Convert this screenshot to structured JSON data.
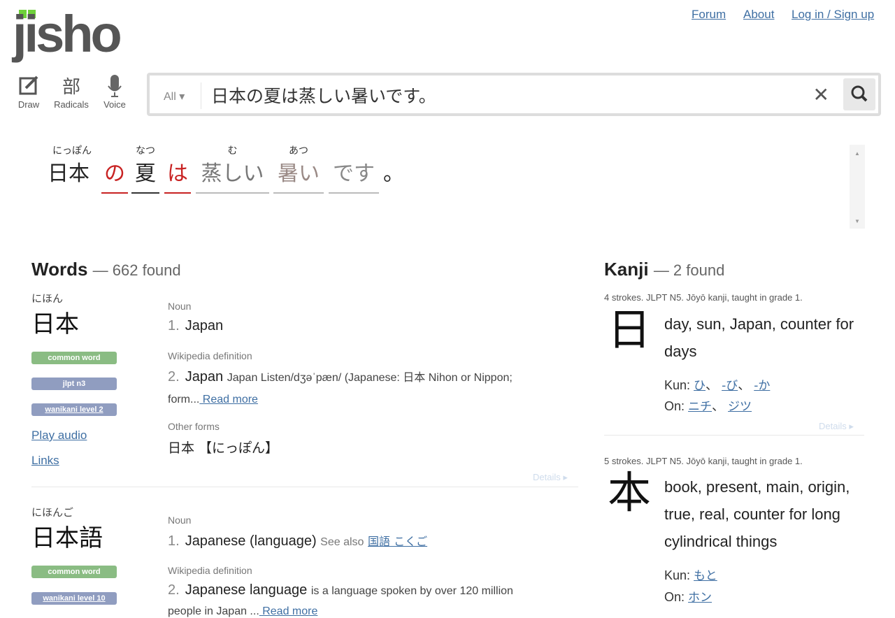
{
  "logo": {
    "text": "jisho",
    "color": "#6ed13a"
  },
  "nav": {
    "forum": "Forum",
    "about": "About",
    "login": "Log in / Sign up"
  },
  "tools": [
    {
      "label": "Draw",
      "icon": "pencil-square-icon"
    },
    {
      "label": "Radicals",
      "glyph": "部"
    },
    {
      "label": "Voice",
      "icon": "microphone-icon"
    }
  ],
  "search": {
    "filter": "All ▾",
    "value": "日本の夏は蒸しい暑いです。",
    "clear": "✕"
  },
  "sentence": [
    {
      "furigana": "にっぽん",
      "text": "日本",
      "color": "#222"
    },
    {
      "furigana": "",
      "text": "の",
      "color": "#c82222"
    },
    {
      "furigana": "なつ",
      "text": "夏",
      "color": "#222"
    },
    {
      "furigana": "",
      "text": "は",
      "color": "#c82222"
    },
    {
      "furigana": "む",
      "text": "蒸しい",
      "color": "#777"
    },
    {
      "furigana": "あつ",
      "text": "暑い",
      "color": "#9a8a86"
    },
    {
      "furigana": "",
      "text": "です",
      "color": "#888"
    },
    {
      "furigana": "",
      "text": "。",
      "color": "#222"
    }
  ],
  "words": {
    "title": "Words",
    "count": "— 662 found",
    "entries": [
      {
        "reading": "にほん",
        "word": "日本",
        "tags": [
          "common word",
          "jlpt n3",
          "wanikani level 2"
        ],
        "play_audio": "Play audio",
        "links": "Links",
        "pos1": "Noun",
        "m1_num": "1.",
        "m1": "Japan",
        "pos2": "Wikipedia definition",
        "m2_num": "2.",
        "m2": "Japan",
        "m2_desc": "Japan Listen/dʒəˈpæn/ (Japanese: 日本 Nihon or Nippon;",
        "m2_desc2": "form...",
        "read_more": " Read more",
        "other_label": "Other forms",
        "other": "日本 【にっぽん】",
        "details": "Details ▸"
      },
      {
        "reading": "にほんご",
        "word": "日本語",
        "tags": [
          "common word",
          "wanikani level 10"
        ],
        "pos1": "Noun",
        "m1_num": "1.",
        "m1": "Japanese (language)",
        "see_also": "See also",
        "see_link": "国語 こくご",
        "pos2": "Wikipedia definition",
        "m2_num": "2.",
        "m2": "Japanese language",
        "m2_desc": "is a language spoken by over 120 million",
        "m2_desc2": "people in Japan ...",
        "read_more": " Read more"
      }
    ]
  },
  "kanji": {
    "title": "Kanji",
    "count": "— 2 found",
    "entries": [
      {
        "meta": "4 strokes. JLPT N5. Jōyō kanji, taught in grade 1.",
        "kanji": "日",
        "meaning": "day, sun, Japan, counter for days",
        "kun_label": "Kun:",
        "kun": [
          "ひ",
          "-び",
          "-か"
        ],
        "on_label": "On:",
        "on": [
          "ニチ",
          "ジツ"
        ],
        "details": "Details ▸"
      },
      {
        "meta": "5 strokes. JLPT N5. Jōyō kanji, taught in grade 1.",
        "kanji": "本",
        "meaning": "book, present, main, origin, true, real, counter for long cylindrical things",
        "kun_label": "Kun:",
        "kun": [
          "もと"
        ],
        "on_label": "On:",
        "on": [
          "ホン"
        ]
      }
    ]
  }
}
